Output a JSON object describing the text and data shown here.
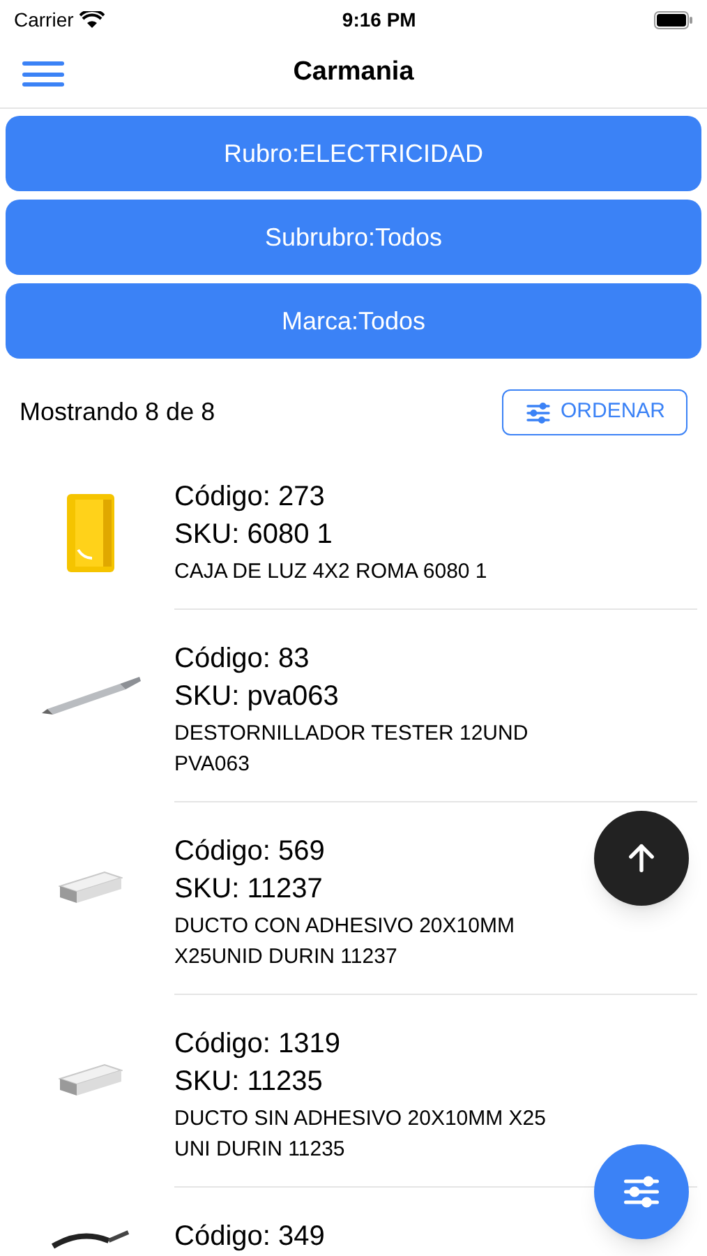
{
  "status_bar": {
    "carrier": "Carrier",
    "time": "9:16 PM"
  },
  "nav": {
    "title": "Carmania"
  },
  "filters": [
    {
      "label": "Rubro:ELECTRICIDAD"
    },
    {
      "label": "Subrubro:Todos"
    },
    {
      "label": "Marca:Todos"
    }
  ],
  "summary": {
    "count_text": "Mostrando 8 de 8",
    "sort_button": "ORDENAR"
  },
  "products": [
    {
      "code": "Código: 273",
      "sku": "SKU: 6080 1",
      "description_lines": [
        "CAJA DE LUZ 4X2 ROMA 6080 1"
      ],
      "kind": "box"
    },
    {
      "code": "Código: 83",
      "sku": "SKU: pva063",
      "description_lines": [
        "DESTORNILLADOR TESTER 12UND",
        "PVA063"
      ],
      "kind": "screwdriver"
    },
    {
      "code": "Código: 569",
      "sku": "SKU: 11237",
      "description_lines": [
        "DUCTO CON ADHESIVO 20X10MM",
        "X25UNID DURIN 11237"
      ],
      "kind": "duct"
    },
    {
      "code": "Código: 1319",
      "sku": "SKU: 11235",
      "description_lines": [
        "DUCTO SIN ADHESIVO 20X10MM X25",
        "UNI DURIN 11235"
      ],
      "kind": "duct"
    },
    {
      "code": "Código: 349",
      "kind": "tool"
    }
  ]
}
